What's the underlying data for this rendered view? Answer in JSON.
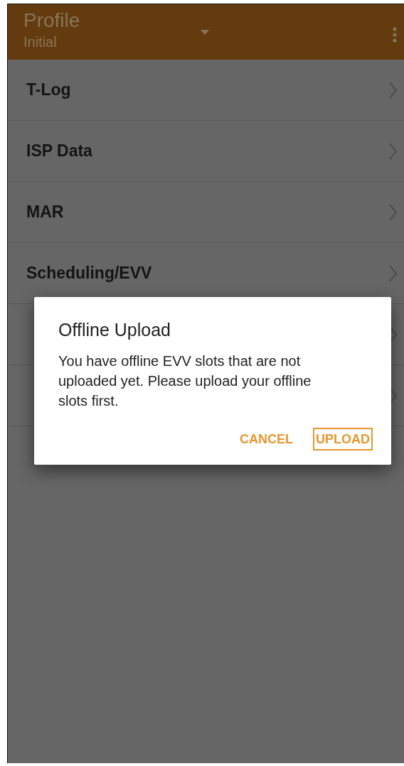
{
  "app_bar": {
    "title": "Profile",
    "subtitle": "Initial"
  },
  "menu_items": [
    {
      "label": "T-Log"
    },
    {
      "label": "ISP Data"
    },
    {
      "label": "MAR"
    },
    {
      "label": "Scheduling/EVV"
    }
  ],
  "dialog": {
    "title": "Offline Upload",
    "message": "You have offline EVV slots that are not uploaded yet. Please upload your offline slots first.",
    "buttons": [
      {
        "label": "CANCEL",
        "focused": false
      },
      {
        "label": "UPLOAD",
        "focused": true
      }
    ]
  }
}
